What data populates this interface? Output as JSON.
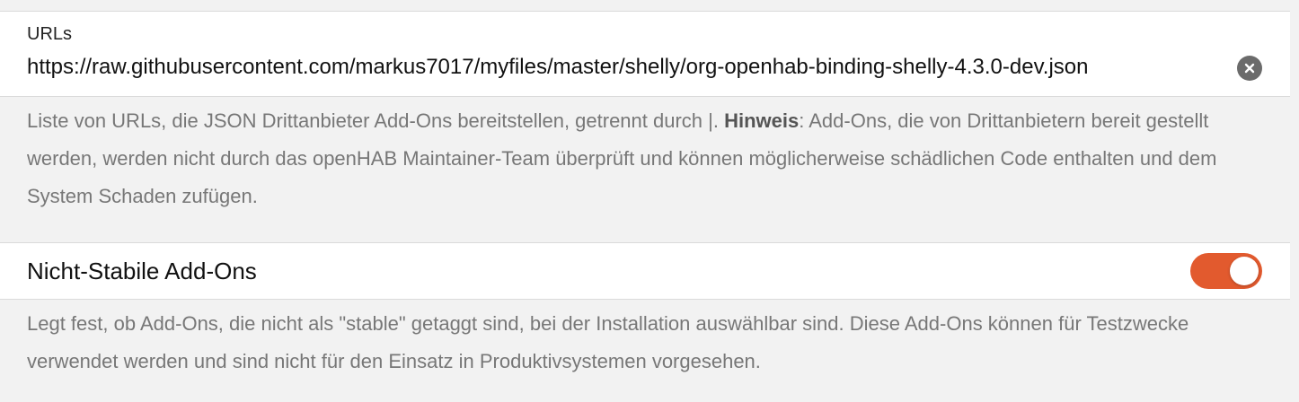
{
  "urls_field": {
    "label": "URLs",
    "value": "https://raw.githubusercontent.com/markus7017/myfiles/master/shelly/org-openhab-binding-shelly-4.3.0-dev.json",
    "clear_icon": "clear-circle-icon",
    "description_prefix": "Liste von URLs, die JSON Drittanbieter Add-Ons bereitstellen, getrennt durch |. ",
    "description_bold": "Hinweis",
    "description_suffix": ": Add-Ons, die von Drittanbietern bereit gestellt werden, werden nicht durch das openHAB Maintainer-Team überprüft und können möglicherweise schädlichen Code enthalten und dem System Schaden zufügen."
  },
  "unstable_toggle": {
    "label": "Nicht-Stabile Add-Ons",
    "enabled": true,
    "description": "Legt fest, ob Add-Ons, die nicht als \"stable\" getaggt sind, bei der Installation auswählbar sind. Diese Add-Ons können für Testzwecke verwendet werden und sind nicht für den Einsatz in Produktivsystemen vorgesehen."
  },
  "colors": {
    "accent": "#e25a2e",
    "background": "#f2f2f2",
    "card": "#ffffff",
    "description_text": "#777777"
  }
}
